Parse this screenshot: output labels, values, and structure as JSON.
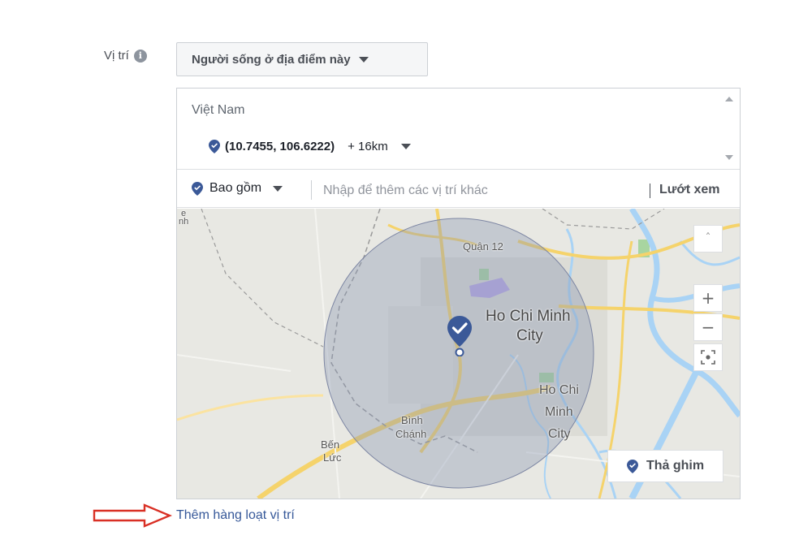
{
  "location": {
    "label": "Vị trí",
    "info_icon": "info-icon",
    "audience_dropdown": "Người sống ở địa điểm này",
    "country": "Việt Nam",
    "pin": {
      "coords": "(10.7455, 106.6222)",
      "radius": "+ 16km"
    },
    "include_dropdown": "Bao gồm",
    "search_placeholder": "Nhập để thêm các vị trí khác",
    "browse_label": "Lướt xem",
    "bulk_add_link": "Thêm hàng loạt vị trí"
  },
  "map": {
    "labels": {
      "quan12": "Quận 12",
      "hcm1": "Ho Chi Minh",
      "hcm2": "City",
      "hcm_small1": "Ho Chi",
      "hcm_small2": "Minh",
      "hcm_small3": "City",
      "binh": "Bình",
      "chanh": "Chánh",
      "ben": "Bến",
      "luc": "Lức",
      "edge1": "e",
      "edge2": "nh"
    },
    "zoom_in": "+",
    "zoom_out": "−",
    "drop_pin_label": "Thả ghim",
    "colors": {
      "water": "#a9d3f5",
      "major_road": "#f5d36b",
      "radius_fill": "#8a97b4",
      "pin": "#3b5998"
    }
  },
  "annotation": {
    "arrow_color": "#d93025"
  }
}
